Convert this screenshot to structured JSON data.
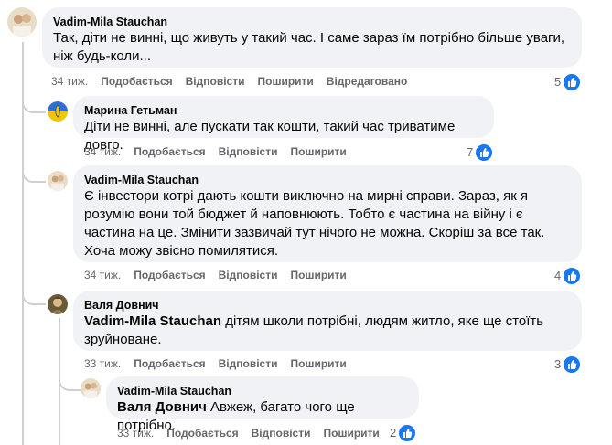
{
  "comments": [
    {
      "author": "Vadim-Mila Stauchan",
      "text": "Так, діти не винні, що живуть у такий час. І саме зараз їм потрібно більше уваги, ніж будь-коли...",
      "time": "34 тиж.",
      "like_label": "Подобається",
      "reply_label": "Відповісти",
      "share_label": "Поширити",
      "edited_label": "Відредаговано",
      "reactions": "5"
    },
    {
      "author": "Марина Гетьман",
      "text": "Діти не винні, але пускати так кошти, такий час триватиме довго.",
      "time": "34 тиж.",
      "like_label": "Подобається",
      "reply_label": "Відповісти",
      "share_label": "Поширити",
      "reactions": "7"
    },
    {
      "author": "Vadim-Mila Stauchan",
      "text": "Є інвестори котрі дають кошти виключно на мирні справи. Зараз, як я розумію вони той бюджет й наповнюють. Тобто є частина на війну і є частина на це. Змінити зазвичай тут нічого не можна. Скоріш за все так. Хоча можу звісно помилятися.",
      "time": "34 тиж.",
      "like_label": "Подобається",
      "reply_label": "Відповісти",
      "share_label": "Поширити",
      "reactions": "4"
    },
    {
      "author": "Валя Довнич",
      "mention": "Vadim-Mila Stauchan",
      "text": " дітям школи потрібні, людям житло, яке ще стоїть зруйноване.",
      "time": "33 тиж.",
      "like_label": "Подобається",
      "reply_label": "Відповісти",
      "share_label": "Поширити",
      "reactions": "3"
    },
    {
      "author": "Vadim-Mila Stauchan",
      "mention": "Валя Довнич",
      "text": " Авжеж, багато чого ще потрібно.",
      "time": "33 тиж.",
      "like_label": "Подобається",
      "reply_label": "Відповісти",
      "share_label": "Поширити",
      "reactions": "2"
    }
  ],
  "colors": {
    "bubble": "#f0f2f5",
    "meta_text": "#65676b",
    "like_blue": "#1877f2",
    "thread_line": "#ced0d4"
  },
  "icons": {
    "reaction": "thumbs-up-icon"
  }
}
